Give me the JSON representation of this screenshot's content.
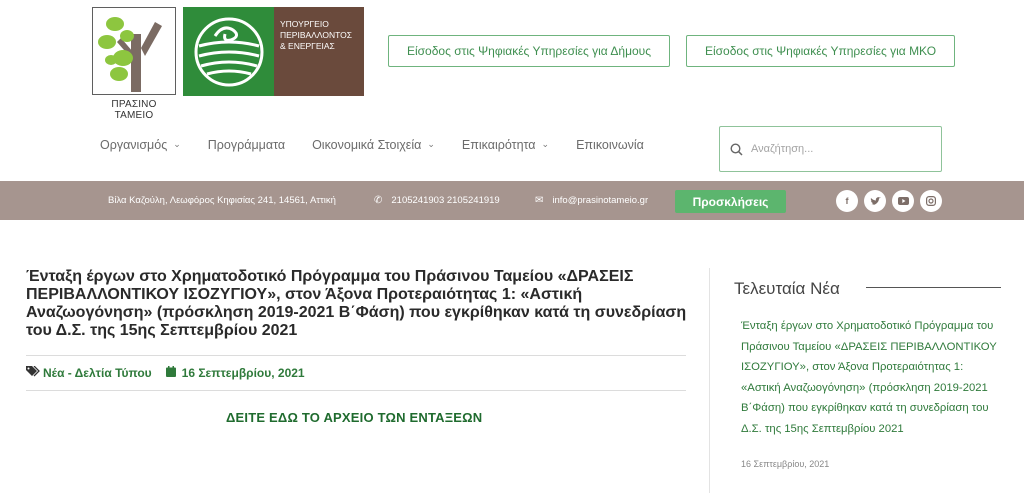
{
  "header": {
    "logo_fund_text": "ΠΡΑΣΙΝΟ ΤΑΜΕΙΟ",
    "ministry_lines": [
      "ΥΠΟΥΡΓΕΙΟ",
      "ΠΕΡΙΒΑΛΛΟΝΤΟΣ",
      "& ΕΝΕΡΓΕΙΑΣ"
    ],
    "btn_municipality": "Είσοδος στις Ψηφιακές Υπηρεσίες για Δήμους",
    "btn_ngo": "Είσοδος στις Ψηφιακές Υπηρεσίες για ΜΚΟ"
  },
  "nav": {
    "items": [
      {
        "label": "Οργανισμός",
        "has_dropdown": true
      },
      {
        "label": "Προγράμματα",
        "has_dropdown": false
      },
      {
        "label": "Οικονομικά Στοιχεία",
        "has_dropdown": true
      },
      {
        "label": "Επικαιρότητα",
        "has_dropdown": true
      },
      {
        "label": "Επικοινωνία",
        "has_dropdown": false
      }
    ],
    "search_placeholder": "Αναζήτηση..."
  },
  "infobar": {
    "address": "Βίλα Καζούλη, Λεωφόρος Κηφισίας 241, 14561, Αττική",
    "phones": "2105241903 2105241919",
    "email": "info@prasinotameio.gr",
    "calls_button": "Προσκλήσεις",
    "social": [
      "facebook",
      "twitter",
      "youtube",
      "instagram"
    ]
  },
  "article": {
    "title": "Ένταξη έργων στο Χρηματοδοτικό Πρόγραμμα του Πράσινου Ταμείου «ΔΡΑΣΕΙΣ ΠΕΡΙΒΑΛΛΟΝΤΙΚΟΥ ΙΣΟΖΥΓΙΟΥ», στον Άξονα Προτεραιότητας 1: «Αστική Αναζωογόνηση» (πρόσκληση 2019-2021 Β΄Φάση) που εγκρίθηκαν κατά τη συνεδρίαση του Δ.Σ. της 15ης Σεπτεμβρίου 2021",
    "category": "Νέα - Δελτία Τύπου",
    "date": "16 Σεπτεμβρίου, 2021",
    "link_text": "ΔΕΙΤΕ ΕΔΩ ΤΟ ΑΡΧΕΙΟ ΤΩΝ ΕΝΤΑΞΕΩΝ"
  },
  "sidebar": {
    "title": "Τελευταία Νέα",
    "news_title": "Ένταξη έργων στο Χρηματοδοτικό Πρόγραμμα του Πράσινου Ταμείου «ΔΡΑΣΕΙΣ ΠΕΡΙΒΑΛΛΟΝΤΙΚΟΥ ΙΣΟΖΥΓΙΟΥ», στον Άξονα Προτεραιότητας 1: «Αστική Αναζωογόνηση» (πρόσκληση 2019-2021 Β΄Φάση) που εγκρίθηκαν κατά τη συνεδρίαση του Δ.Σ. της 15ης Σεπτεμβρίου 2021",
    "news_date": "16 Σεπτεμβρίου, 2021"
  },
  "colors": {
    "brand_green": "#2f8c3a",
    "brand_brown": "#6a4a3c",
    "infobar_bg": "#a6958f",
    "calls_button_bg": "#5cb56e",
    "link_green": "#2f7a3b"
  }
}
